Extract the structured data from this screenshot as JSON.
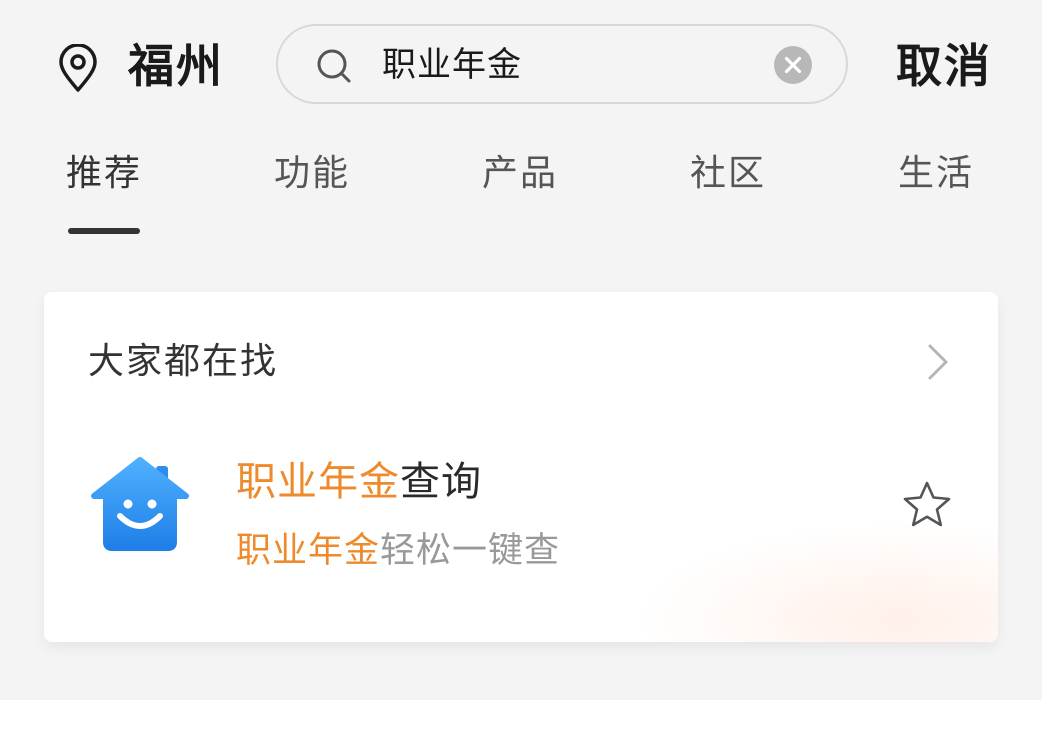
{
  "header": {
    "city": "福州",
    "search_value": "职业年金",
    "cancel_label": "取消",
    "icons": {
      "location": "location-pin-icon",
      "search": "search-icon",
      "clear": "clear-icon"
    }
  },
  "tabs": [
    {
      "label": "推荐",
      "active": true
    },
    {
      "label": "功能",
      "active": false
    },
    {
      "label": "产品",
      "active": false
    },
    {
      "label": "社区",
      "active": false
    },
    {
      "label": "生活",
      "active": false
    }
  ],
  "card": {
    "title": "大家都在找",
    "more_icon": "chevron-right-icon",
    "result": {
      "logo_icon": "smiley-house-icon",
      "name_highlight": "职业年金",
      "name_rest": "查询",
      "desc_highlight": "职业年金",
      "desc_rest": "轻松一键查",
      "favorite_icon": "star-icon"
    }
  },
  "colors": {
    "highlight": "#ee8a2c",
    "background": "#f4f4f4",
    "card": "#ffffff",
    "logo_blue": "#2f8cf2"
  }
}
